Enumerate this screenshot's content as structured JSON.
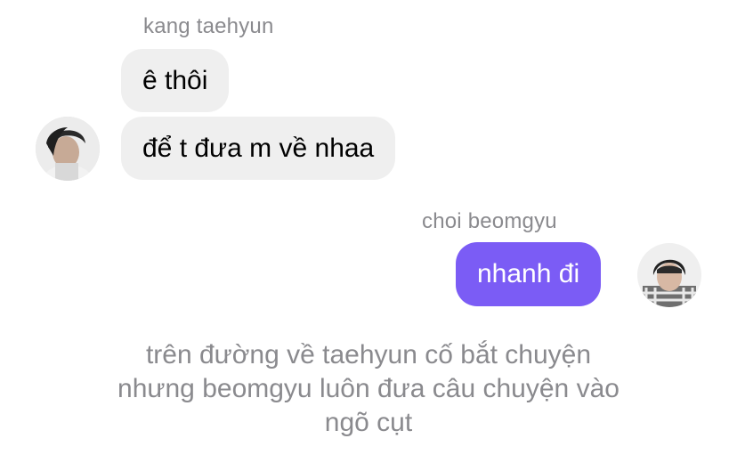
{
  "incoming": {
    "sender": "kang taehyun",
    "avatar_icon": "profile-photo-dark-hair-icon",
    "messages": [
      "ê thôi",
      "để t đưa m về nhaa"
    ]
  },
  "outgoing": {
    "sender": "choi beomgyu",
    "avatar_icon": "profile-photo-plaid-shirt-icon",
    "messages": [
      "nhanh đi"
    ]
  },
  "narration": {
    "lines": [
      "trên đường về taehyun cố bắt chuyện",
      "nhưng beomgyu luôn đưa câu chuyện vào",
      "ngõ cụt"
    ]
  },
  "colors": {
    "incoming_bubble": "#efefef",
    "outgoing_bubble": "#7b5cf5",
    "meta_text": "#8a8a8e"
  }
}
